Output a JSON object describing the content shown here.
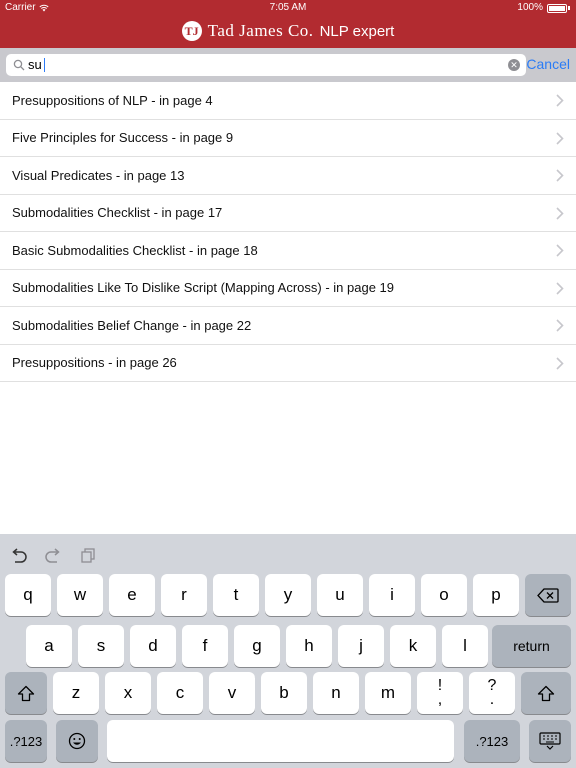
{
  "status_bar": {
    "carrier": "Carrier",
    "time": "7:05 AM",
    "battery": "100%"
  },
  "header": {
    "logo_initials": "TJ",
    "brand_name": "Tad James Co.",
    "brand_suffix": "NLP expert",
    "background_color": "#b22b30"
  },
  "search": {
    "value": "su",
    "cancel_label": "Cancel",
    "accent_color": "#2a7cf6"
  },
  "results": [
    {
      "label": "Presuppositions of NLP - in page 4"
    },
    {
      "label": "Five Principles for Success - in page 9"
    },
    {
      "label": "Visual Predicates - in page 13"
    },
    {
      "label": "Submodalities Checklist - in page 17"
    },
    {
      "label": "Basic Submodalities Checklist - in page 18"
    },
    {
      "label": "Submodalities Like To Dislike Script (Mapping Across) - in page 19"
    },
    {
      "label": "Submodalities Belief Change - in page 22"
    },
    {
      "label": "Presuppositions - in page 26"
    }
  ],
  "keyboard": {
    "row1": [
      "q",
      "w",
      "e",
      "r",
      "t",
      "y",
      "u",
      "i",
      "o",
      "p"
    ],
    "row2": [
      "a",
      "s",
      "d",
      "f",
      "g",
      "h",
      "j",
      "k",
      "l"
    ],
    "row3": [
      "z",
      "x",
      "c",
      "v",
      "b",
      "n",
      "m"
    ],
    "punct1": [
      "!",
      ","
    ],
    "punct2": [
      "?",
      "."
    ],
    "return_label": "return",
    "numbers_label": ".?123",
    "toolbar_icons": [
      "undo-icon",
      "redo-icon",
      "paste-icon"
    ]
  }
}
